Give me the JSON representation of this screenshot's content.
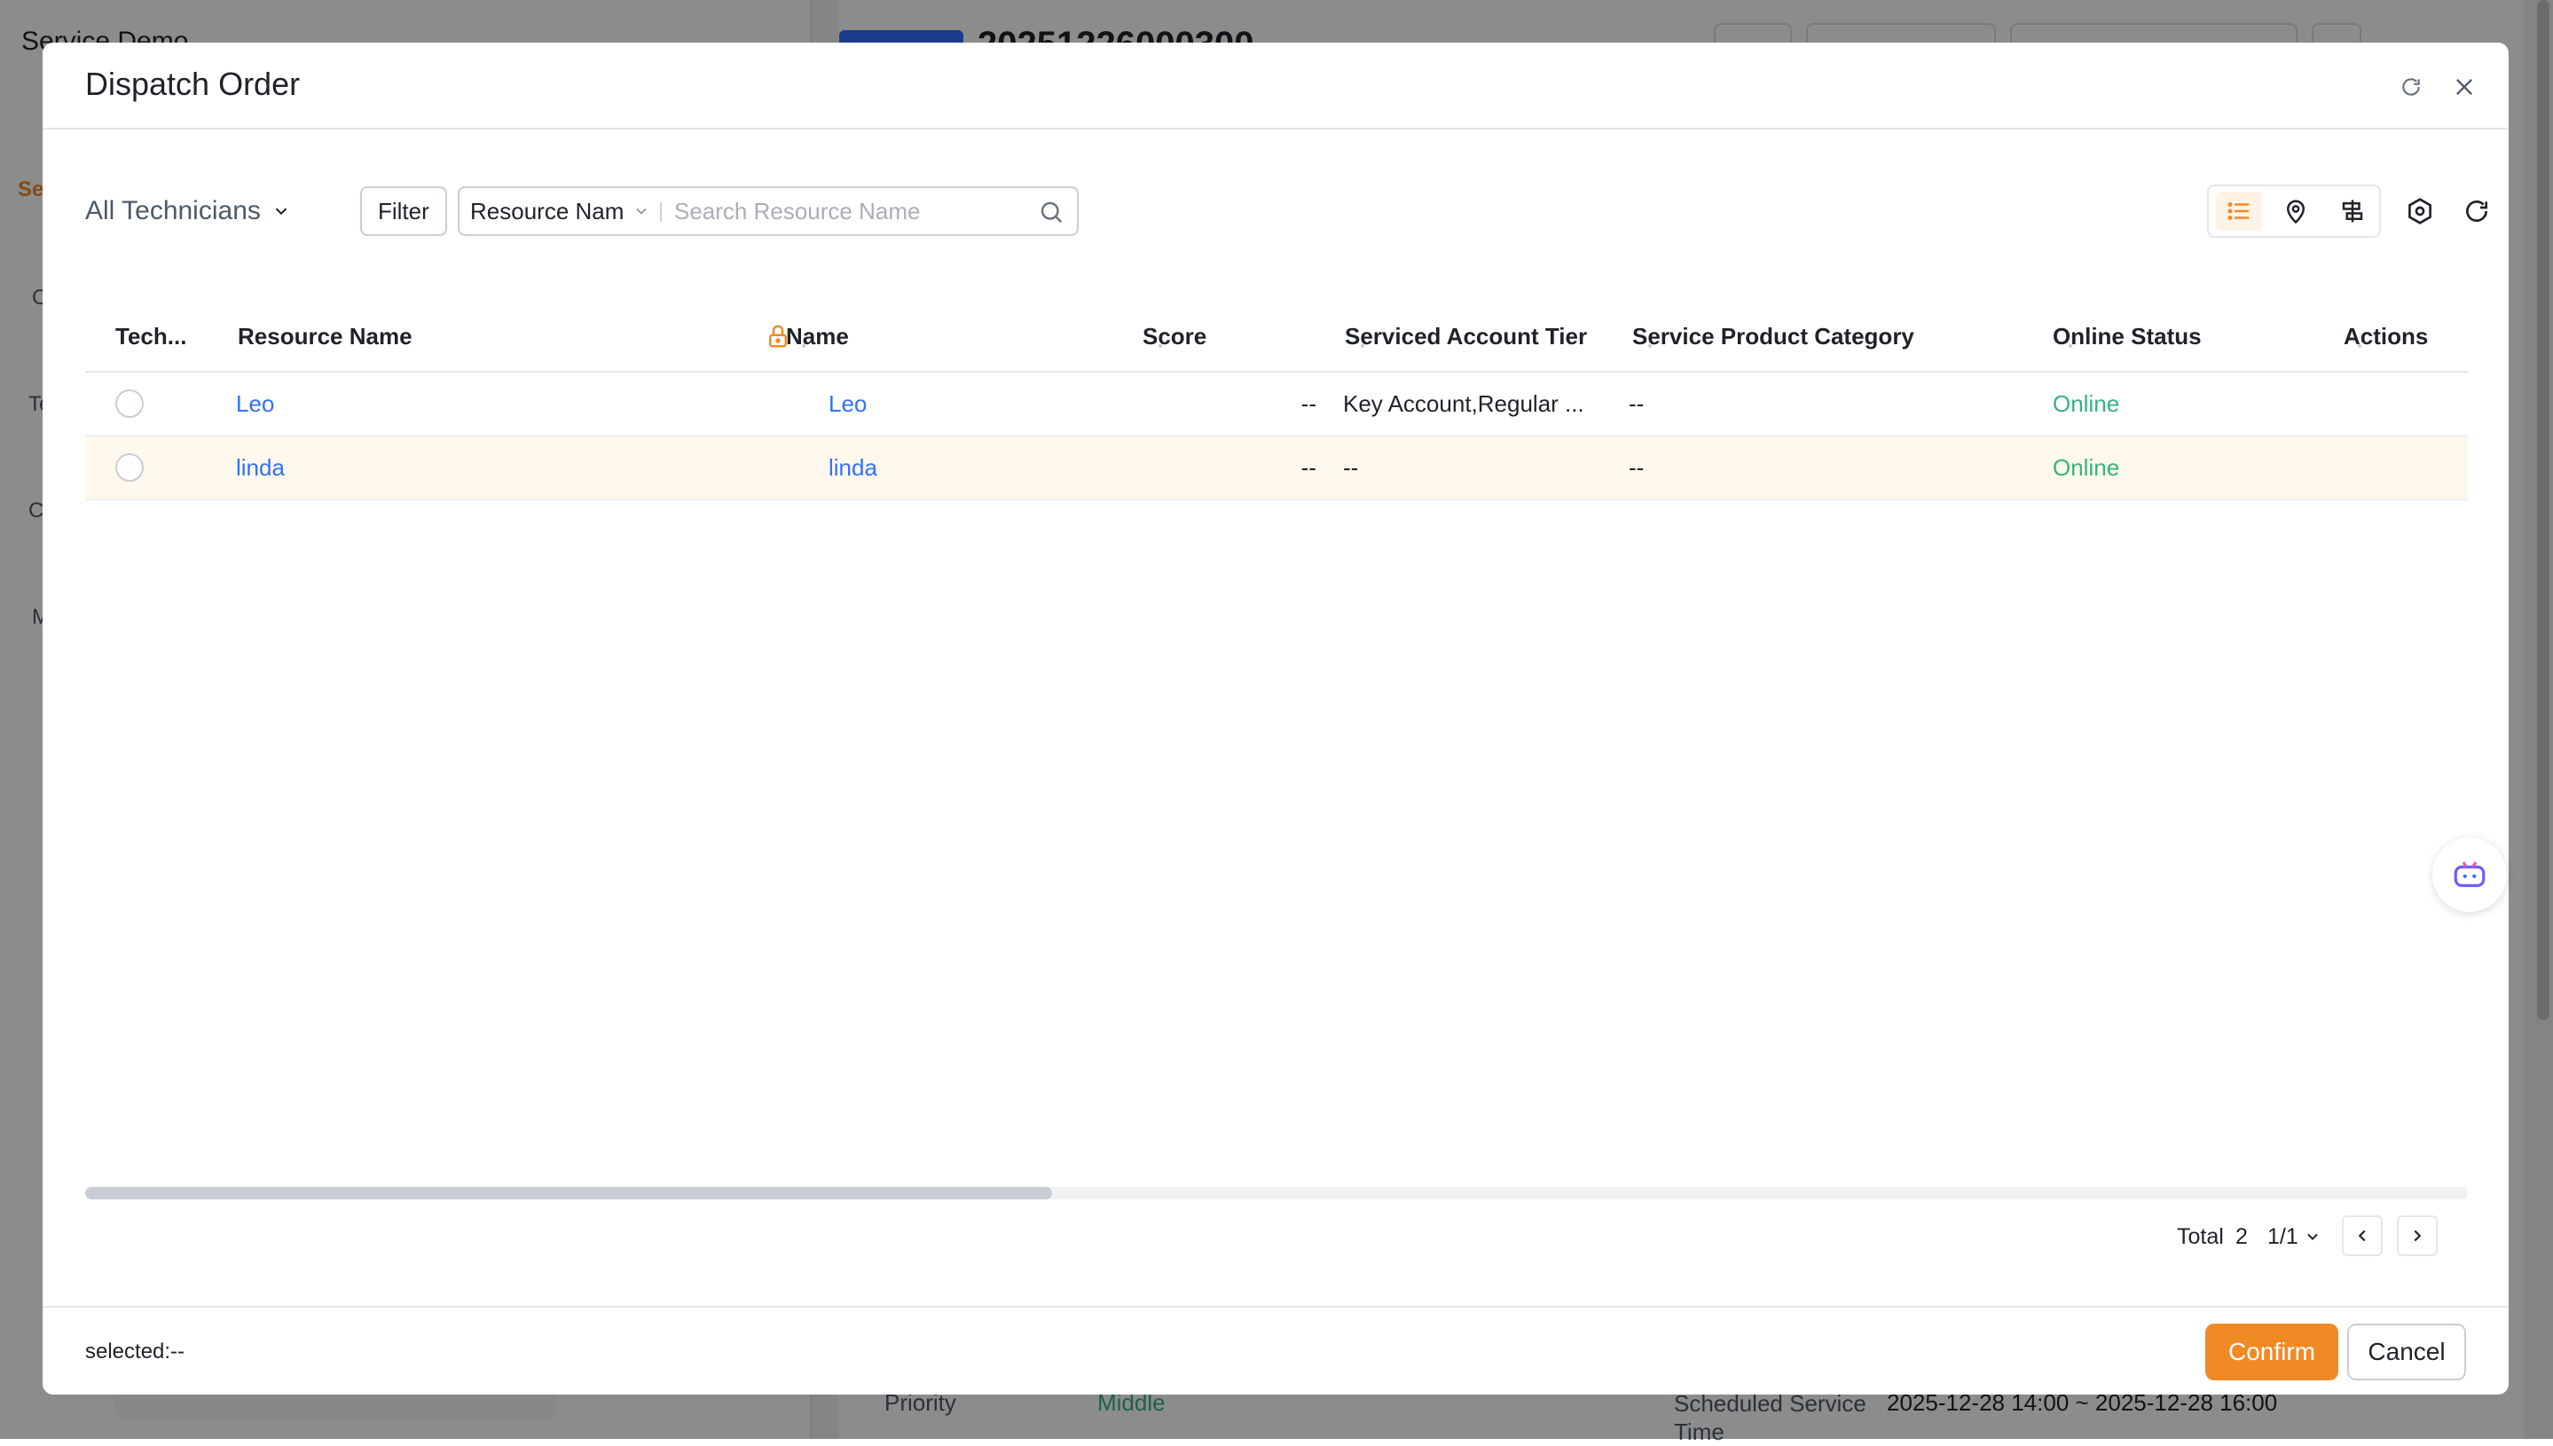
{
  "background": {
    "app_title": "Service Demo",
    "left_tab": "Se",
    "left_labels": [
      "C",
      "Te",
      "C",
      "M"
    ],
    "order_number": "20251226000300",
    "priority_label": "Priority",
    "priority_value": "Middle",
    "scheduled_label": "Scheduled Service Time",
    "scheduled_value": "2025-12-28 14:00 ~ 2025-12-28 16:00"
  },
  "modal": {
    "title": "Dispatch Order",
    "icons": {
      "refresh": "refresh-icon",
      "close": "close-icon"
    }
  },
  "toolbar": {
    "technicians_select": "All Technicians",
    "filter_label": "Filter",
    "search_field": "Resource Nam",
    "search_placeholder": "Search Resource Name",
    "view_buttons": [
      "list-view-icon",
      "map-pin-icon",
      "schedule-view-icon"
    ],
    "active_view": "list-view-icon",
    "settings_icon": "settings-icon",
    "reload_icon": "refresh-icon"
  },
  "table": {
    "columns": [
      "Tech...",
      "Resource Name",
      "Name",
      "Score",
      "Serviced Account Tier",
      "Service Product Category",
      "Online Status",
      "Actions"
    ],
    "rows": [
      {
        "resource_name": "Leo",
        "name": "Leo",
        "score": "--",
        "tier": "Key Account,Regular ...",
        "category": "--",
        "status": "Online",
        "highlighted": false
      },
      {
        "resource_name": "linda",
        "name": "linda",
        "score": "--",
        "tier": "--",
        "category": "--",
        "status": "Online",
        "highlighted": true
      }
    ]
  },
  "pagination": {
    "total_label": "Total",
    "total": "2",
    "page": "1/1"
  },
  "footer": {
    "selected": "selected:--",
    "confirm_label": "Confirm",
    "cancel_label": "Cancel"
  },
  "colors": {
    "accent": "#f08a24",
    "link": "#3370ff",
    "online": "#36b37e",
    "row_highlight": "#fff8ec"
  }
}
